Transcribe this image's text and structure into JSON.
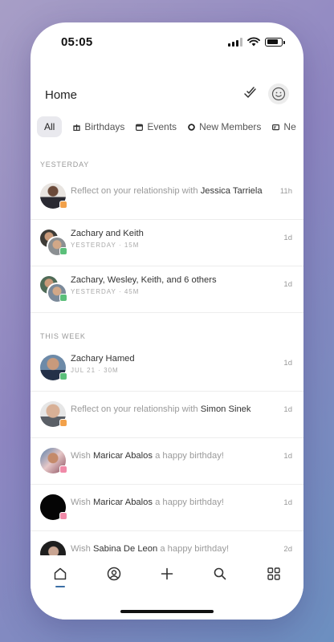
{
  "status": {
    "time": "05:05"
  },
  "header": {
    "title": "Home"
  },
  "filters": [
    {
      "label": "All",
      "active": true,
      "icon": "none"
    },
    {
      "label": "Birthdays",
      "active": false,
      "icon": "gift-icon"
    },
    {
      "label": "Events",
      "active": false,
      "icon": "calendar-icon"
    },
    {
      "label": "New Members",
      "active": false,
      "icon": "ring-icon"
    },
    {
      "label": "Ne",
      "active": false,
      "icon": "card-icon"
    }
  ],
  "sections": [
    {
      "label": "YESTERDAY",
      "items": [
        {
          "pre": "Reflect on your relationship with ",
          "name": "Jessica Tarriela",
          "post": "",
          "time": "11h"
        },
        {
          "title": "Zachary and Keith",
          "meta": "YESTERDAY · 15M",
          "time": "1d"
        },
        {
          "title": "Zachary, Wesley, Keith, and 6 others",
          "meta": "YESTERDAY · 45M",
          "time": "1d"
        }
      ]
    },
    {
      "label": "THIS WEEK",
      "items": [
        {
          "title": "Zachary Hamed",
          "meta": "JUL 21 · 30M",
          "time": "1d"
        },
        {
          "pre": "Reflect on your relationship with ",
          "name": "Simon Sinek",
          "post": "",
          "time": "1d"
        },
        {
          "pre": "Wish ",
          "name": "Maricar Abalos",
          "post": " a happy birthday!",
          "time": "1d"
        },
        {
          "pre": "Wish ",
          "name": "Maricar Abalos",
          "post": " a happy birthday!",
          "time": "1d"
        },
        {
          "pre": "Wish ",
          "name": "Sabina De Leon",
          "post": " a happy birthday!",
          "time": "2d"
        }
      ]
    }
  ],
  "colors": {
    "accent": "#3b6ea5",
    "badge_orange": "#f2a14a",
    "badge_green": "#5bbf7a",
    "badge_pink": "#f08aa8"
  }
}
